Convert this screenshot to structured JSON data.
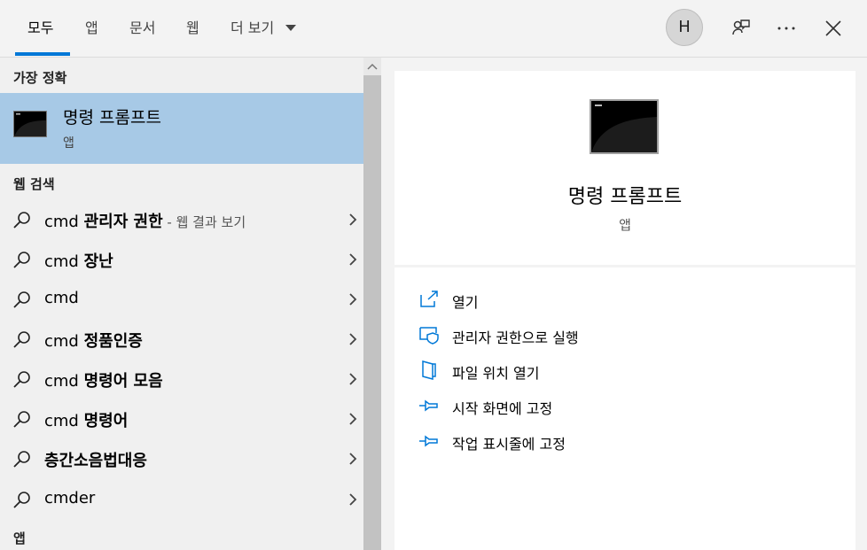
{
  "tabs": {
    "all": "모두",
    "apps": "앱",
    "documents": "문서",
    "web": "웹",
    "more": "더 보기"
  },
  "user": {
    "avatar_initial": "H"
  },
  "left": {
    "best_match_header": "가장 정확",
    "best_match": {
      "title": "명령 프롬프트",
      "subtitle": "앱"
    },
    "web_search_header": "웹 검색",
    "suggestions": [
      {
        "prefix": "cmd ",
        "bold": "관리자 권한",
        "hint": " - 웹 결과 보기"
      },
      {
        "prefix": "cmd ",
        "bold": "장난",
        "hint": ""
      },
      {
        "prefix": "cmd",
        "bold": "",
        "hint": ""
      },
      {
        "prefix": "cmd ",
        "bold": "정품인증",
        "hint": ""
      },
      {
        "prefix": "cmd ",
        "bold": "명령어 모음",
        "hint": ""
      },
      {
        "prefix": "cmd ",
        "bold": "명령어",
        "hint": ""
      },
      {
        "prefix": "",
        "bold": "층간소음법대응",
        "hint": ""
      },
      {
        "prefix": "cmder",
        "bold": "",
        "hint": ""
      }
    ],
    "apps_header": "앱"
  },
  "preview": {
    "title": "명령 프롬프트",
    "subtitle": "앱",
    "actions": [
      {
        "label": "열기",
        "icon": "open-icon"
      },
      {
        "label": "관리자 권한으로 실행",
        "icon": "shield-icon"
      },
      {
        "label": "파일 위치 열기",
        "icon": "file-location-icon"
      },
      {
        "label": "시작 화면에 고정",
        "icon": "pin-icon"
      },
      {
        "label": "작업 표시줄에 고정",
        "icon": "pin-icon"
      }
    ]
  },
  "colors": {
    "accent": "#0078d7",
    "selection": "#a7c9e6"
  }
}
